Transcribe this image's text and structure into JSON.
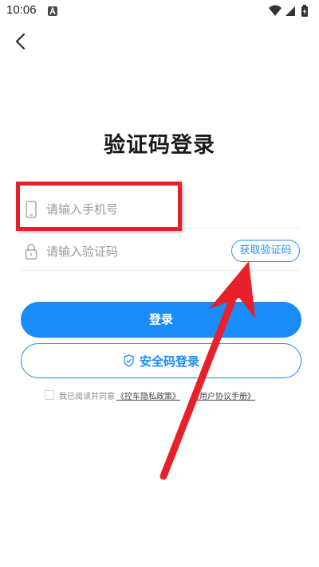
{
  "status_bar": {
    "time": "10:06",
    "icons": [
      "notification-a-icon",
      "wifi-icon",
      "signal-icon",
      "battery-charging-icon"
    ]
  },
  "header": {
    "back_icon": "chevron-left-icon"
  },
  "page": {
    "title": "验证码登录"
  },
  "form": {
    "phone": {
      "icon": "phone-icon",
      "placeholder": "请输入手机号",
      "value": ""
    },
    "code": {
      "icon": "lock-icon",
      "placeholder": "请输入验证码",
      "value": "",
      "get_code_label": "获取验证码"
    },
    "login_label": "登录",
    "secure_login_label": "安全码登录",
    "secure_login_icon": "shield-check-icon"
  },
  "agreement": {
    "checked": false,
    "text": "我已阅读并同意",
    "privacy_link": "《控车隐私政策》",
    "user_link": "《用户协议手册》"
  },
  "colors": {
    "accent": "#1a8cf8",
    "annotation": "#e5202a"
  }
}
